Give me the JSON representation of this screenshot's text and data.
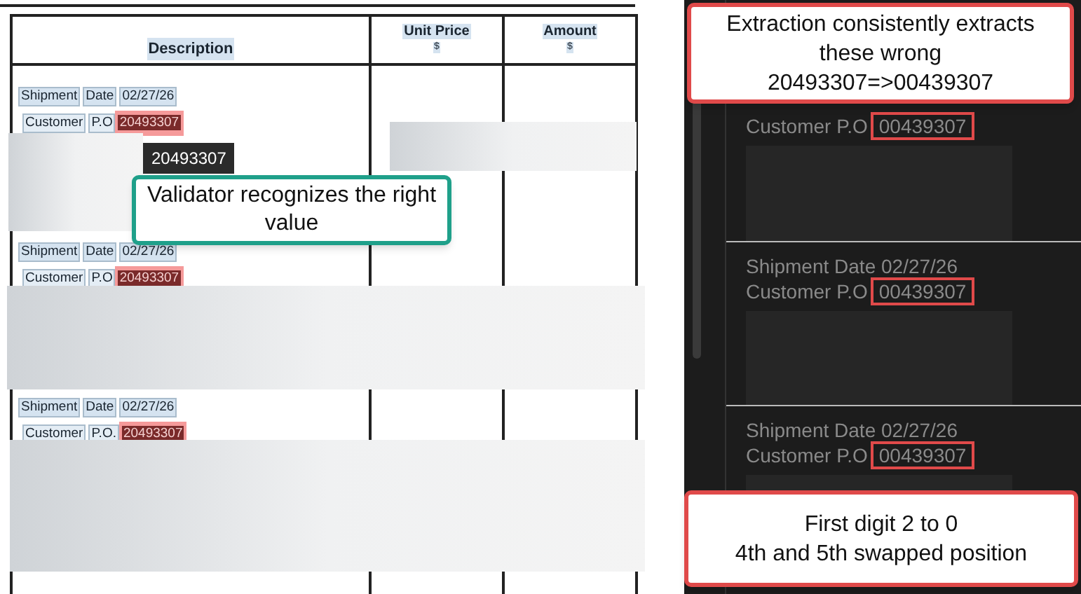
{
  "document": {
    "columns": [
      {
        "label": "Description"
      },
      {
        "label": "Unit Price",
        "unit": "$"
      },
      {
        "label": "Amount",
        "unit": "$"
      }
    ],
    "entries": [
      {
        "shipment_words": [
          "Shipment",
          "Date",
          "02/27/26"
        ],
        "po_words": [
          "Customer",
          "P.O"
        ],
        "po_value": "20493307"
      },
      {
        "shipment_words": [
          "Shipment",
          "Date",
          "02/27/26"
        ],
        "po_words": [
          "Customer",
          "P.O"
        ],
        "po_value": "20493307"
      },
      {
        "shipment_words": [
          "Shipment",
          "Date",
          "02/27/26"
        ],
        "po_words": [
          "Customer",
          "P.O."
        ],
        "po_value": "20493307"
      }
    ],
    "tooltip": "20493307"
  },
  "validator_note": "Validator recognizes the right value",
  "results": {
    "entries": [
      {
        "po_label": "Customer P.O",
        "po_value": "00439307"
      },
      {
        "shipment": "Shipment Date 02/27/26",
        "po_label": "Customer P.O",
        "po_value": "00439307"
      },
      {
        "shipment": "Shipment Date 02/27/26",
        "po_label": "Customer P.O",
        "po_value": "00439307"
      }
    ]
  },
  "extraction_note": [
    "Extraction consistently extracts",
    "these wrong",
    "20493307=>00439307"
  ],
  "error_note": [
    "First digit 2 to 0",
    "4th and 5th swapped position"
  ]
}
